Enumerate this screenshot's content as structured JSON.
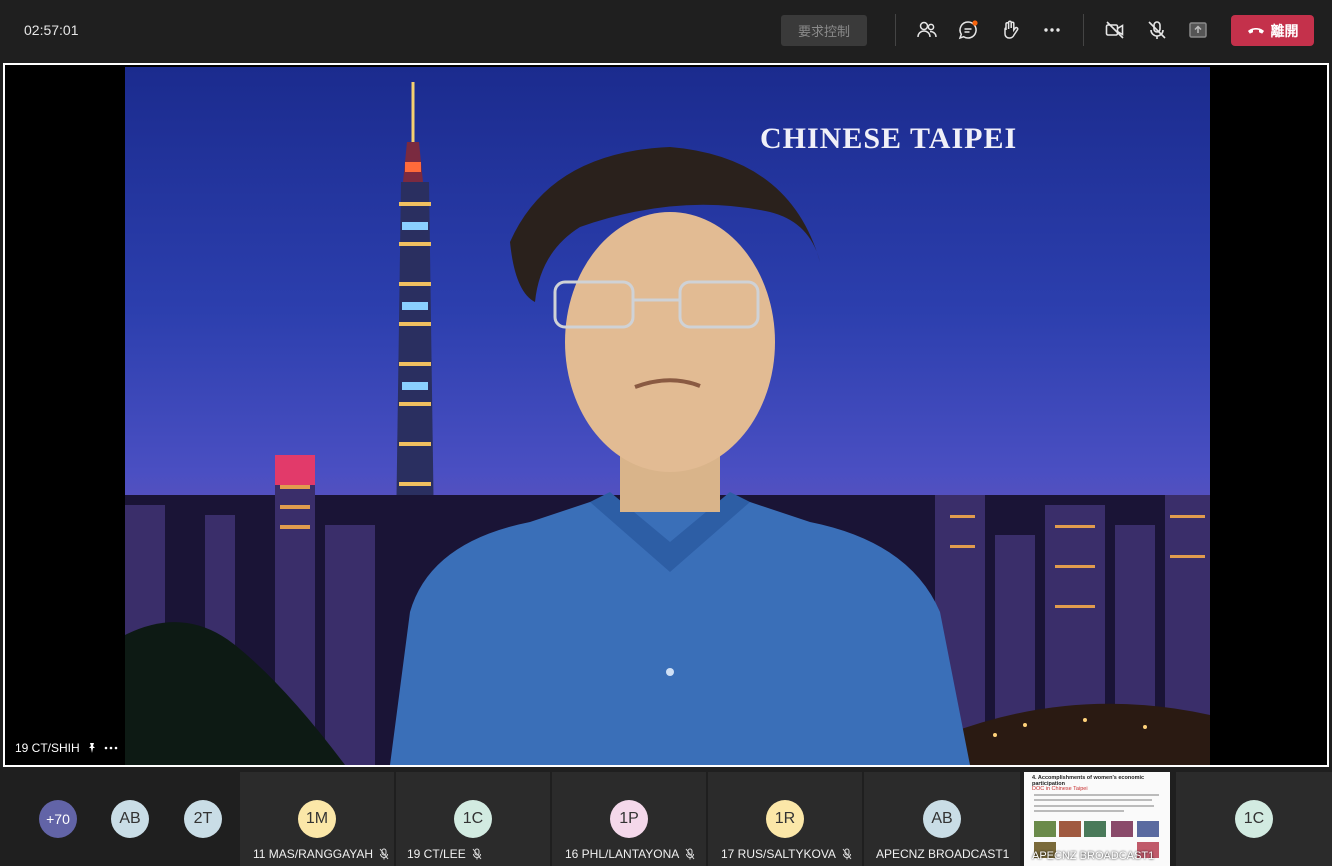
{
  "toolbar": {
    "timer": "02:57:01",
    "request_control_label": "要求控制",
    "leave_label": "離開",
    "colors": {
      "leave": "#c4314b",
      "chat_badge": "#f7630c"
    }
  },
  "main_video": {
    "caption": "CHINESE TAIPEI",
    "participant_label": "19 CT/SHIH"
  },
  "gallery": {
    "overflow_count": "+70",
    "avatars": [
      {
        "initials": "AB",
        "color": "#c9dde6"
      },
      {
        "initials": "2T",
        "color": "#c9dde6"
      }
    ],
    "participants": [
      {
        "initials": "1M",
        "name": "11 MAS/RANGGAYAH",
        "color": "#fbe7a8",
        "muted": true
      },
      {
        "initials": "1C",
        "name": "19 CT/LEE",
        "color": "#d2ebe1",
        "muted": true
      },
      {
        "initials": "1P",
        "name": "16 PHL/LANTAYONA",
        "color": "#f4d8ea",
        "muted": true
      },
      {
        "initials": "1R",
        "name": "17 RUS/SALTYKOVA",
        "color": "#fbe7a8",
        "muted": true
      },
      {
        "initials": "AB",
        "name": "APECNZ BROADCAST1",
        "color": "#c9dde6",
        "muted": false
      }
    ],
    "shared_screen": {
      "title": "4. Accomplishments of women's economic participation",
      "subtitle": "DOC in Chinese Taipei",
      "label": "APECNZ BROADCAST1"
    },
    "last_avatar": {
      "initials": "1C",
      "color": "#d2ebe1"
    }
  }
}
